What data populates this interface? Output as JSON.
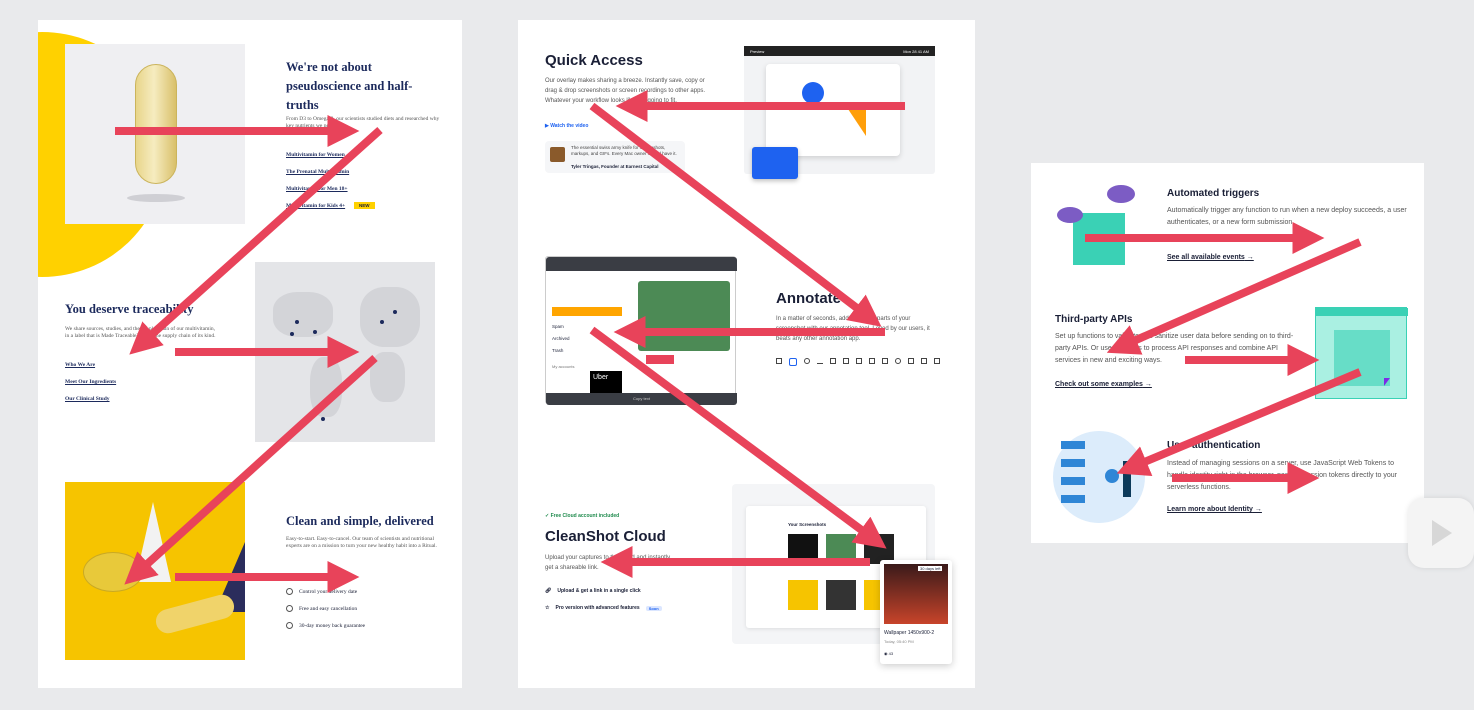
{
  "panel1": {
    "hero": {
      "title": "We're not about pseudoscience and half-truths",
      "body": "From D3 to Omega-3, our scientists studied diets and researched why key nutrients we need.",
      "links": [
        "Multivitamin for Women",
        "The Prenatal Multivitamin",
        "Multivitamin for Men 18+",
        "Multivitamin for Kids 4+"
      ],
      "new_badge": "NEW"
    },
    "trace": {
      "title": "You deserve traceability",
      "body": "We share sources, studies, and the supply chain of our multivitamin, in a label that is Made Traceable™ with the supply chain of its kind.",
      "links": [
        "Who We Are",
        "Meet Our Ingredients",
        "Our Clinical Study"
      ]
    },
    "clean": {
      "title": "Clean and simple, delivered",
      "body": "Easy-to-start. Easy-to-cancel. Our team of scientists and nutritional experts are on a mission to turn your new healthy habit into a Ritual.",
      "features": [
        "Control your delivery date",
        "Free and easy cancellation",
        "30-day money back guarantee"
      ]
    }
  },
  "panel2": {
    "quick": {
      "title": "Quick Access",
      "body": "Our overlay makes sharing a breeze. Instantly save, copy or drag & drop screenshots or screen recordings to other apps. Whatever your workflow looks like, it's going to fit.",
      "watch": "Watch the video",
      "quote": "The essential swiss army knife for screenshots, markups, and GIFs. Every Mac owner should have it.",
      "author": "Tyler Tringas, Founder at Earnest Capital",
      "preview_title": "Preview",
      "menubar_time": "Mon 28 41 AM"
    },
    "annotate": {
      "title": "Annotate",
      "body": "In a matter of seconds, add important parts of your screenshot with our annotation tool. Loved by our users, it beats any other annotation app.",
      "sidebar": [
        "Spam",
        "Archived",
        "Trash"
      ],
      "accounts": "My accounts",
      "uber": "Uber",
      "copy_label": "Copy text"
    },
    "cloud": {
      "badge": "Free Cloud account included",
      "title": "CleanShot Cloud",
      "body": "Upload your captures to the cloud and instantly get a shareable link.",
      "features": [
        "Upload & get a link in a single click",
        "Pro version with advanced features"
      ],
      "soon": "Soon",
      "screens_label": "Your Screenshots",
      "card_title": "Wallpaper 1450x900-2",
      "card_sub": "Today, 05:40 PM",
      "card_tag": "30 days left",
      "card_views": "43"
    }
  },
  "panel3": {
    "triggers": {
      "title": "Automated triggers",
      "body": "Automatically trigger any function to run when a new deploy succeeds, a user authenticates, or a new form submission",
      "link": "See all available events"
    },
    "apis": {
      "title": "Third-party APIs",
      "body": "Set up functions to validate and sanitize user data before sending on to third-party APIs. Or use functions to process API responses and combine API services in new and exciting ways.",
      "link": "Check out some examples"
    },
    "auth": {
      "title": "User authentication",
      "body": "Instead of managing sessions on a server, use JavaScript Web Tokens to handle identity right in the browser, passing session tokens directly to your serverless functions.",
      "link": "Learn more about Identity"
    }
  },
  "colors": {
    "arrow": "#e8435a",
    "yellow": "#ffd100",
    "navy": "#1c2a5c",
    "teal": "#3ad1b5",
    "blue": "#1e62f0"
  }
}
